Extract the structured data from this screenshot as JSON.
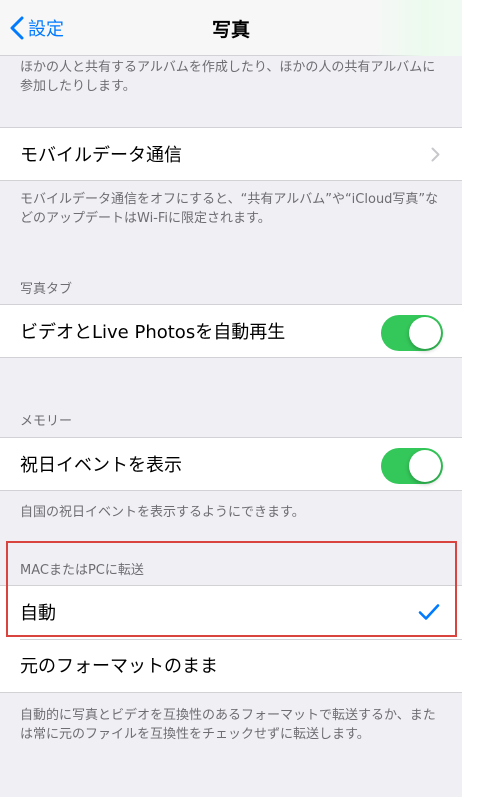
{
  "navbar": {
    "back_label": "設定",
    "title": "写真"
  },
  "shared_album": {
    "footer": "ほかの人と共有するアルバムを作成したり、ほかの人の共有アルバムに参加したりします。"
  },
  "mobile_data": {
    "label": "モバイルデータ通信",
    "footer": "モバイルデータ通信をオフにすると、“共有アルバム”や“iCloud写真”などのアップデートはWi-Fiに限定されます。"
  },
  "photos_tab": {
    "header": "写真タブ",
    "autoplay_label": "ビデオとLive Photosを自動再生",
    "autoplay_on": true
  },
  "memories": {
    "header": "メモリー",
    "holiday_label": "祝日イベントを表示",
    "holiday_on": true,
    "footer": "自国の祝日イベントを表示するようにできます。"
  },
  "transfer": {
    "header": "MACまたはPCに転送",
    "options": [
      {
        "label": "自動",
        "selected": true
      },
      {
        "label": "元のフォーマットのまま",
        "selected": false
      }
    ],
    "footer": "自動的に写真とビデオを互換性のあるフォーマットで転送するか、または常に元のファイルを互換性をチェックせずに転送します。"
  },
  "colors": {
    "accent": "#007aff",
    "toggle_on": "#34c759",
    "highlight": "#d9443f",
    "grouped_bg": "#efeff4"
  }
}
